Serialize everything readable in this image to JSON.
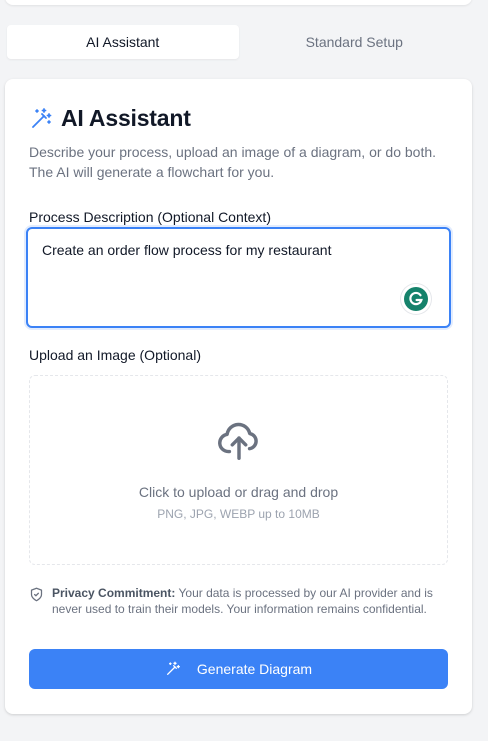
{
  "tabs": [
    {
      "label": "AI Assistant",
      "active": true
    },
    {
      "label": "Standard Setup",
      "active": false
    }
  ],
  "card": {
    "title": "AI Assistant",
    "title_icon": "magic-wand-icon",
    "description": "Describe your process, upload an image of a diagram, or do both. The AI will generate a flowchart for you."
  },
  "process": {
    "label": "Process Description (Optional Context)",
    "value": "Create an order flow process for my restaurant",
    "assistant_icon": "grammarly-icon"
  },
  "upload": {
    "label": "Upload an Image (Optional)",
    "icon": "cloud-upload-icon",
    "main_text": "Click to upload or drag and drop",
    "sub_text": "PNG, JPG, WEBP up to 10MB"
  },
  "privacy": {
    "icon": "shield-icon",
    "heading": "Privacy Commitment:",
    "body": " Your data is processed by our AI provider and is never used to train their models. Your information remains confidential."
  },
  "generate_button": {
    "label": "Generate Diagram",
    "icon": "magic-wand-icon"
  },
  "colors": {
    "accent": "#3b82f6",
    "grammarly": "#15826b",
    "text_muted": "#6b7280"
  }
}
